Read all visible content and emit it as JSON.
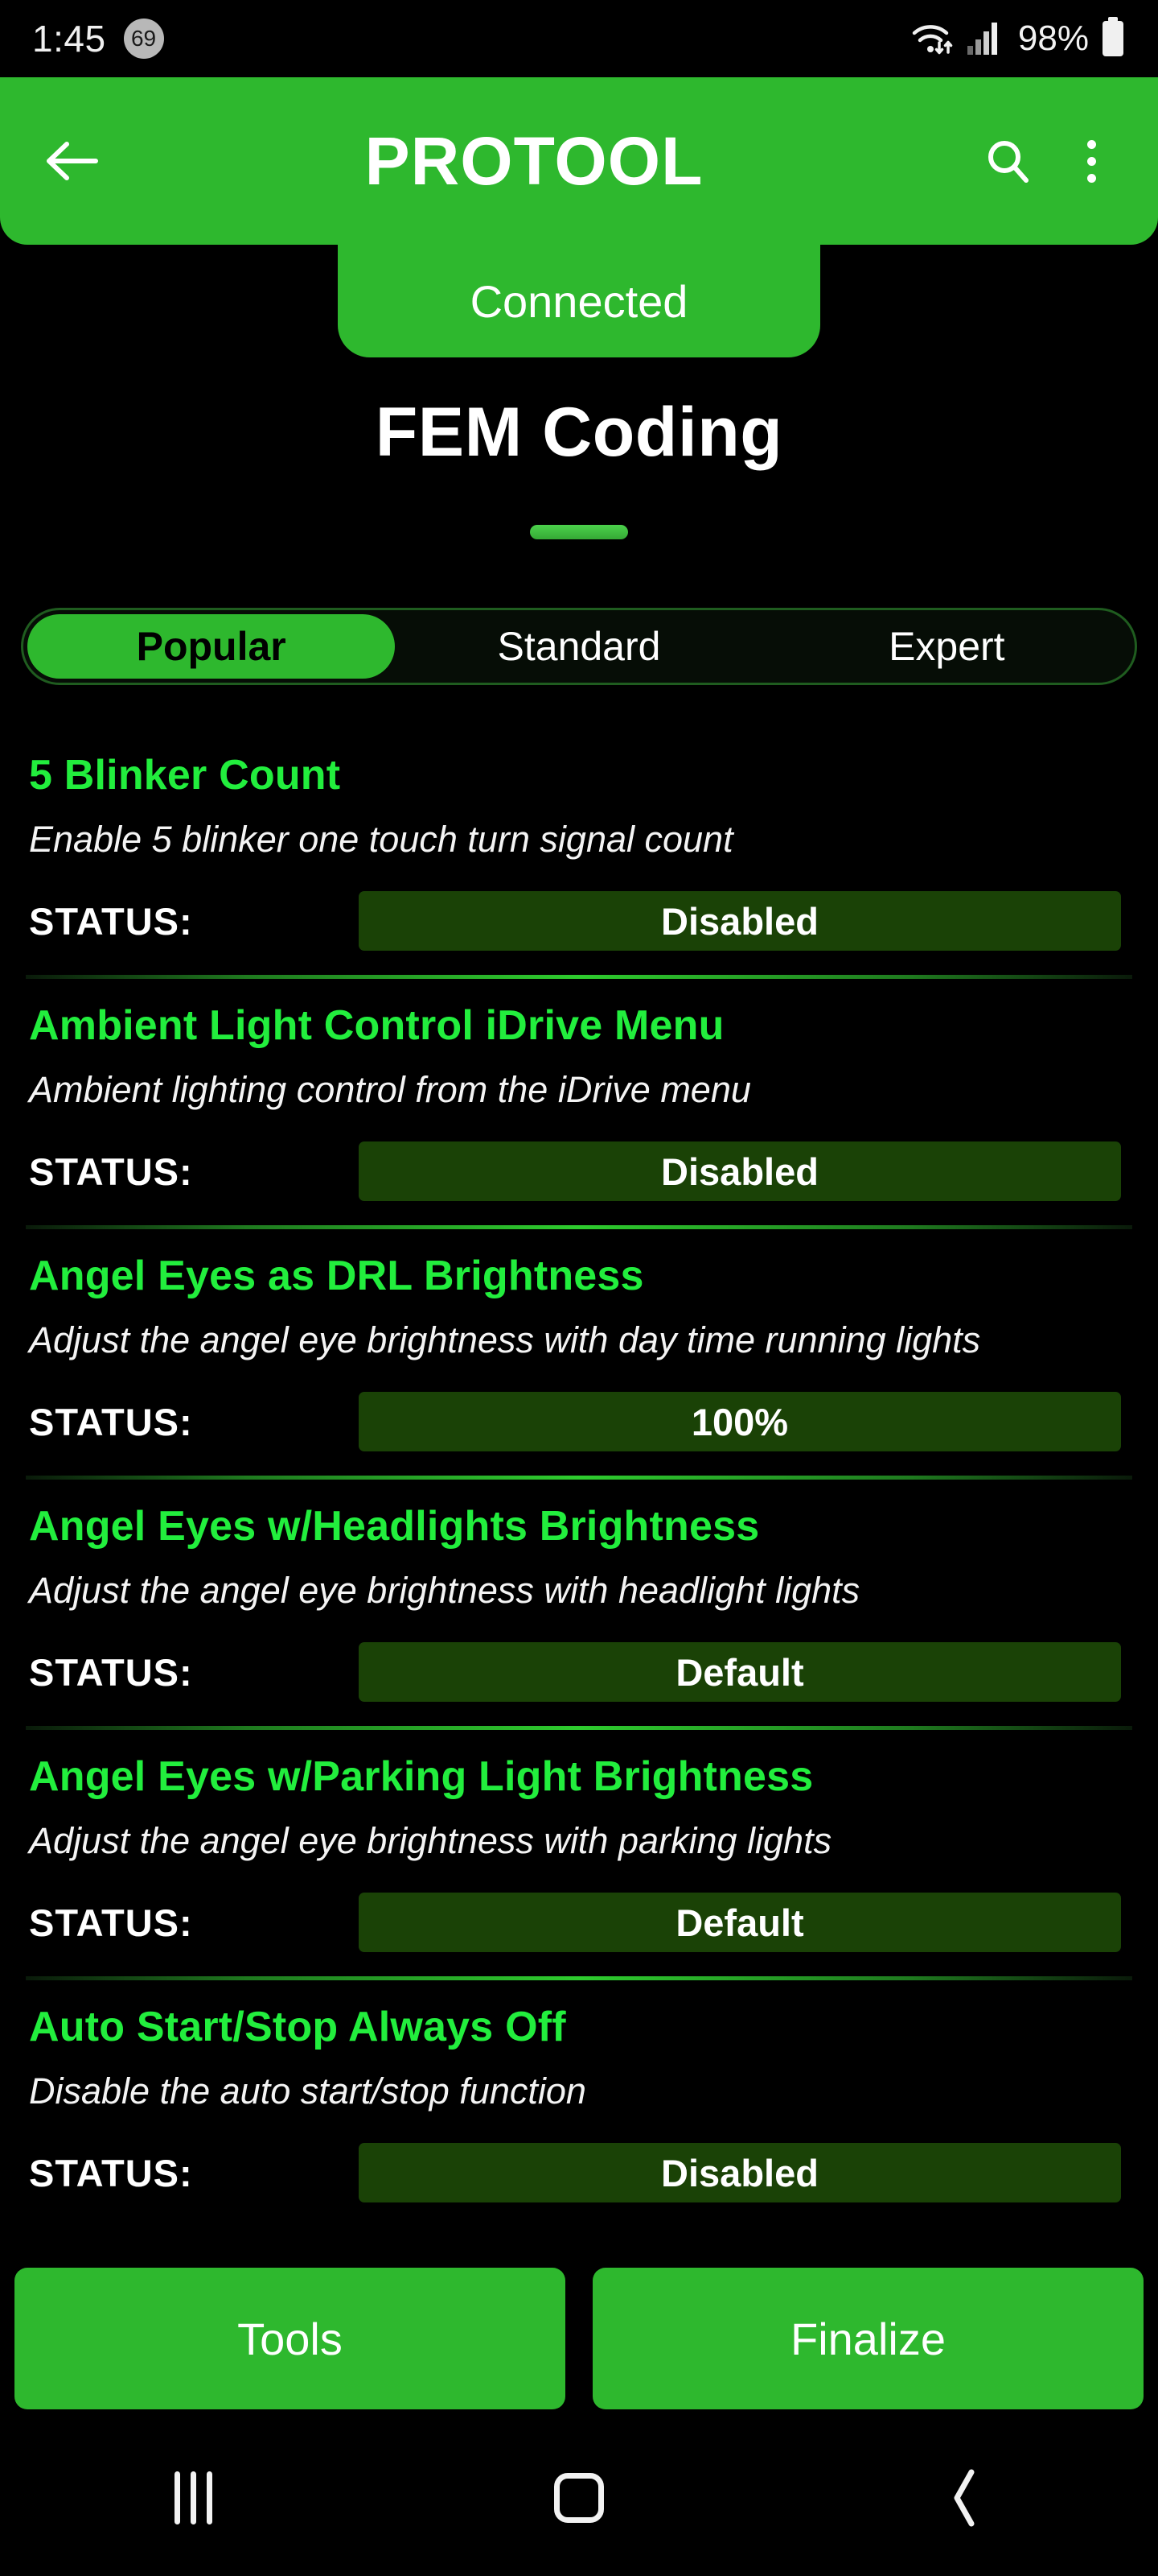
{
  "status_bar": {
    "time": "1:45",
    "notification_count": "69",
    "battery_percent": "98%",
    "icons": [
      "wifi-icon",
      "cellular-signal-icon",
      "battery-icon"
    ]
  },
  "app_bar": {
    "back_icon": "arrow-left-icon",
    "title": "PROTOOL",
    "search_icon": "search-icon",
    "overflow_icon": "more-vertical-icon"
  },
  "connection": {
    "badge_label": "Connected"
  },
  "page": {
    "title": "FEM Coding"
  },
  "tabs": [
    {
      "label": "Popular",
      "active": true
    },
    {
      "label": "Standard",
      "active": false
    },
    {
      "label": "Expert",
      "active": false
    }
  ],
  "status_label": "STATUS:",
  "items": [
    {
      "title": "5 Blinker Count",
      "description": "Enable 5 blinker one touch turn signal count",
      "status": "Disabled"
    },
    {
      "title": "Ambient Light Control iDrive Menu",
      "description": "Ambient lighting control from the iDrive menu",
      "status": "Disabled"
    },
    {
      "title": "Angel Eyes as DRL Brightness",
      "description": "Adjust the angel eye brightness with day time running lights",
      "status": "100%"
    },
    {
      "title": "Angel Eyes w/Headlights Brightness",
      "description": "Adjust the angel eye brightness with headlight lights",
      "status": "Default"
    },
    {
      "title": "Angel Eyes w/Parking Light Brightness",
      "description": "Adjust the angel eye brightness with parking lights",
      "status": "Default"
    },
    {
      "title": "Auto Start/Stop Always Off",
      "description": "Disable the auto start/stop function",
      "status": "Disabled"
    }
  ],
  "bottom_actions": [
    {
      "label": "Tools"
    },
    {
      "label": "Finalize"
    }
  ],
  "nav_bar": {
    "recents_icon": "recents-icon",
    "home_icon": "home-icon",
    "back_icon": "chevron-left-icon"
  },
  "colors": {
    "brand_green": "#2eb82e",
    "title_green": "#22ee3d",
    "status_box_green": "#1a4206",
    "background": "#000000"
  }
}
